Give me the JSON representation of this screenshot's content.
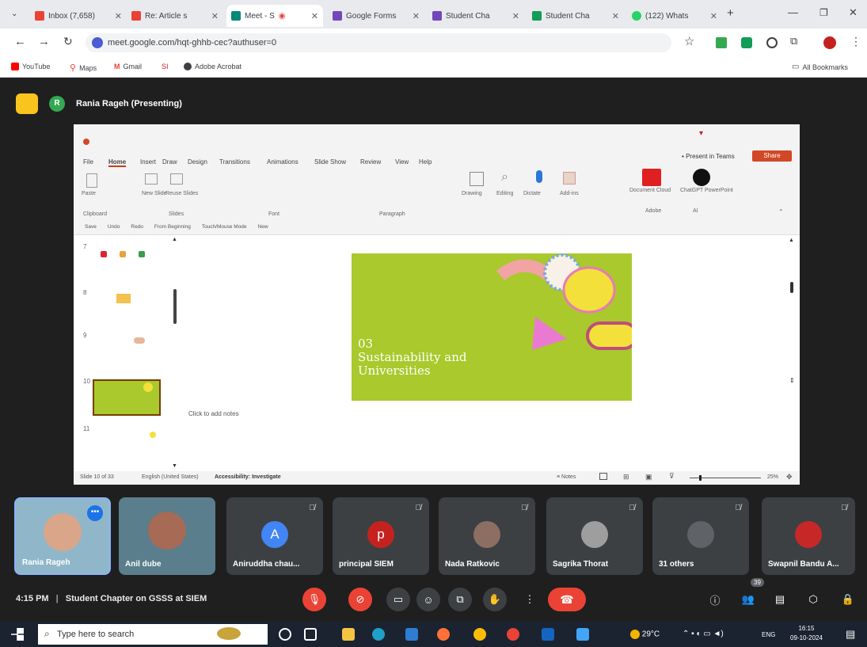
{
  "browser": {
    "tabs": [
      {
        "label": "Inbox (7,658)",
        "color": "#ea4335"
      },
      {
        "label": "Re: Article s",
        "color": "#ea4335"
      },
      {
        "label": "Meet - S",
        "color": "#00897b"
      },
      {
        "label": "Google Forms",
        "color": "#7248b9"
      },
      {
        "label": "Student Cha",
        "color": "#7248b9"
      },
      {
        "label": "Student Cha",
        "color": "#0f9d58"
      },
      {
        "label": "(122) Whats",
        "color": "#25d366"
      }
    ],
    "url": "meet.google.com/hqt-ghhb-cec?authuser=0",
    "bookmarks": [
      "YouTube",
      "Maps",
      "Gmail",
      "SI",
      "Adobe Acrobat"
    ],
    "all_bookmarks": "All Bookmarks"
  },
  "presenter": "Rania Rageh (Presenting)",
  "ppt": {
    "menus": [
      "File",
      "Home",
      "Insert",
      "Draw",
      "Design",
      "Transitions",
      "Animations",
      "Slide Show",
      "Review",
      "View",
      "Help"
    ],
    "present_in_teams": "Present in Teams",
    "share": "Share",
    "ribbon_labels": [
      "Paste",
      "New Slide",
      "Reuse Slides",
      "Clipboard",
      "Slides",
      "Font",
      "Paragraph",
      "Dictate",
      "Add-ins",
      "Drawing",
      "Editing",
      "Document Cloud",
      "ChatGPT PowerPoint",
      "Adobe",
      "AI"
    ],
    "quick_toolbar": [
      "Save",
      "Undo",
      "Redo",
      "From Beginning",
      "Touch/Mouse Mode",
      "New"
    ],
    "thumbnail_numbers": [
      "7",
      "8",
      "9",
      "10",
      "11"
    ],
    "slide_title_number": "03",
    "slide_title": "Sustainability and Universities",
    "notes_placeholder": "Click to add notes",
    "status_left": "Slide 10 of 33",
    "status_language": "English (United States)",
    "status_accessibility": "Accessibility: Investigate",
    "status_notes": "Notes",
    "zoom": "25%"
  },
  "participants": [
    {
      "name": "Rania Rageh",
      "initial": "",
      "color": "#5f6368"
    },
    {
      "name": "Anil dube",
      "initial": "",
      "color": "#5f6368"
    },
    {
      "name": "Aniruddha chau...",
      "initial": "A",
      "color": "#4285f4"
    },
    {
      "name": "principal SIEM",
      "initial": "p",
      "color": "#c5221f"
    },
    {
      "name": "Nada Ratkovic",
      "initial": "",
      "color": "#8d6e63"
    },
    {
      "name": "Sagrika Thorat",
      "initial": "",
      "color": "#9e9e9e"
    },
    {
      "name": "31 others",
      "initial": "",
      "color": "#5f6368"
    },
    {
      "name": "Swapnil Bandu A...",
      "initial": "",
      "color": "#c62828"
    }
  ],
  "meeting": {
    "time": "4:15 PM",
    "title": "Student Chapter on GSSS at SIEM",
    "participant_count": "39"
  },
  "taskbar": {
    "search_placeholder": "Type here to search",
    "weather": "29°C",
    "language": "ENG",
    "clock_time": "16:15",
    "clock_date": "09-10-2024"
  }
}
